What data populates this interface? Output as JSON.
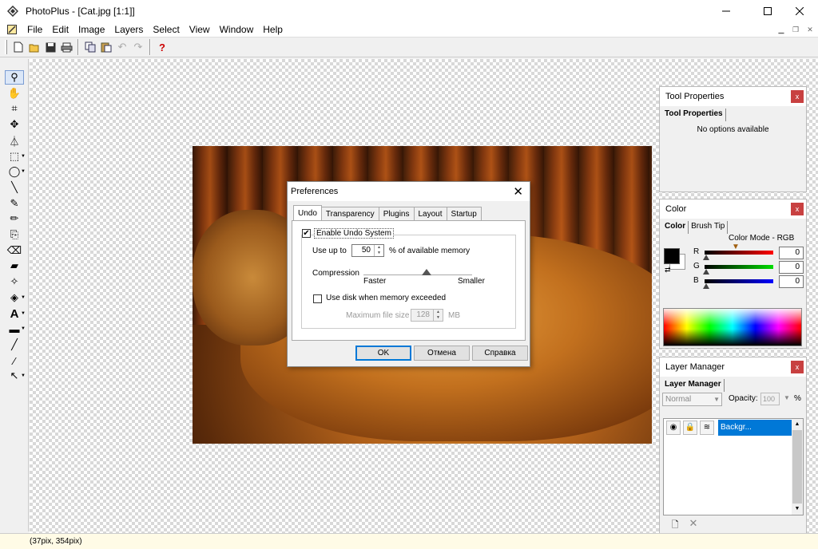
{
  "window": {
    "title": "PhotoPlus - [Cat.jpg [1:1]]"
  },
  "menubar": {
    "items": [
      {
        "label": "File"
      },
      {
        "label": "Edit"
      },
      {
        "label": "Image"
      },
      {
        "label": "Layers"
      },
      {
        "label": "Select"
      },
      {
        "label": "View"
      },
      {
        "label": "Window"
      },
      {
        "label": "Help"
      }
    ]
  },
  "preferences": {
    "title": "Preferences",
    "tabs": [
      "Undo",
      "Transparency",
      "Plugins",
      "Layout",
      "Startup"
    ],
    "active_tab": "Undo",
    "enable_undo_label": "Enable Undo System",
    "enable_undo_checked": true,
    "use_up_to_label": "Use up to",
    "use_up_to_value": "50",
    "memory_suffix": "% of available memory",
    "compression_label": "Compression",
    "compression_faster": "Faster",
    "compression_smaller": "Smaller",
    "use_disk_label": "Use disk when memory exceeded",
    "use_disk_checked": false,
    "max_file_size_label": "Maximum file size",
    "max_file_size_value": "128",
    "max_file_size_unit": "MB",
    "buttons": {
      "ok": "OK",
      "cancel": "Отмена",
      "help": "Справка"
    }
  },
  "tool_properties": {
    "title": "Tool Properties",
    "tab": "Tool Properties",
    "message": "No options available"
  },
  "color_panel": {
    "title": "Color",
    "tabs": [
      "Color",
      "Brush Tip"
    ],
    "mode_label": "Color Mode - RGB",
    "channels": [
      {
        "name": "R",
        "value": "0",
        "color": "#ff0000"
      },
      {
        "name": "G",
        "value": "0",
        "color": "#00cc00"
      },
      {
        "name": "B",
        "value": "0",
        "color": "#0000ff"
      }
    ],
    "foreground_color": "#000000",
    "background_color": "#ffffff"
  },
  "layer_manager": {
    "title": "Layer Manager",
    "tab": "Layer Manager",
    "blend_mode": "Normal",
    "opacity_label": "Opacity:",
    "opacity_value": "100",
    "opacity_unit": "%",
    "layers": [
      {
        "name": "Backgr...",
        "selected": true
      }
    ]
  },
  "statusbar": {
    "text": "(37pix, 354pix)"
  },
  "close_glyph": "x"
}
